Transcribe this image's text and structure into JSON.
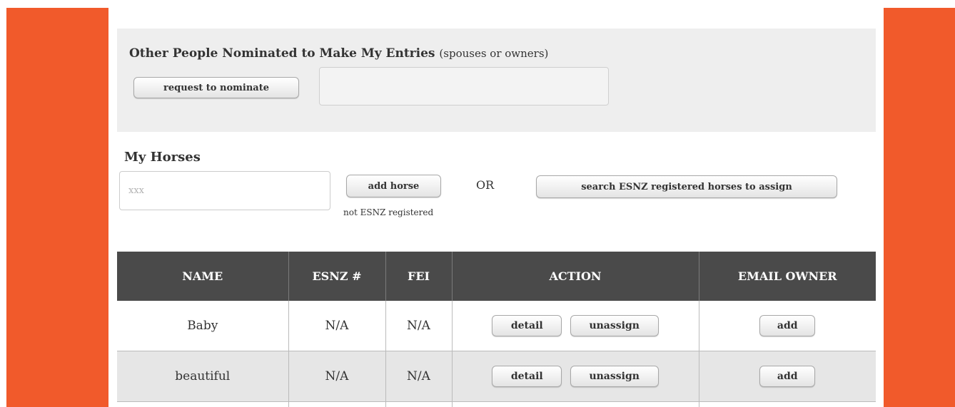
{
  "nominees": {
    "title": "Other People Nominated to Make My Entries",
    "subtitle": "(spouses or owners)",
    "request_button": "request to nominate",
    "field_value": ""
  },
  "horses": {
    "title": "My Horses",
    "input_placeholder": "xxx",
    "input_value": "",
    "add_button": "add horse",
    "add_note": "not ESNZ registered",
    "or_label": "OR",
    "search_button": "search ESNZ registered horses to assign"
  },
  "table": {
    "headers": [
      "NAME",
      "ESNZ #",
      "FEI",
      "ACTION",
      "EMAIL OWNER"
    ],
    "rows": [
      {
        "name": "Baby",
        "esnz": "N/A",
        "fei": "N/A",
        "detail": "detail",
        "unassign": "unassign",
        "email": "add"
      },
      {
        "name": "beautiful",
        "esnz": "N/A",
        "fei": "N/A",
        "detail": "detail",
        "unassign": "unassign",
        "email": "add"
      }
    ]
  },
  "colors": {
    "side_band": "#f15a2b",
    "table_header": "#4a4a4a",
    "panel_bg": "#eeeeee"
  }
}
